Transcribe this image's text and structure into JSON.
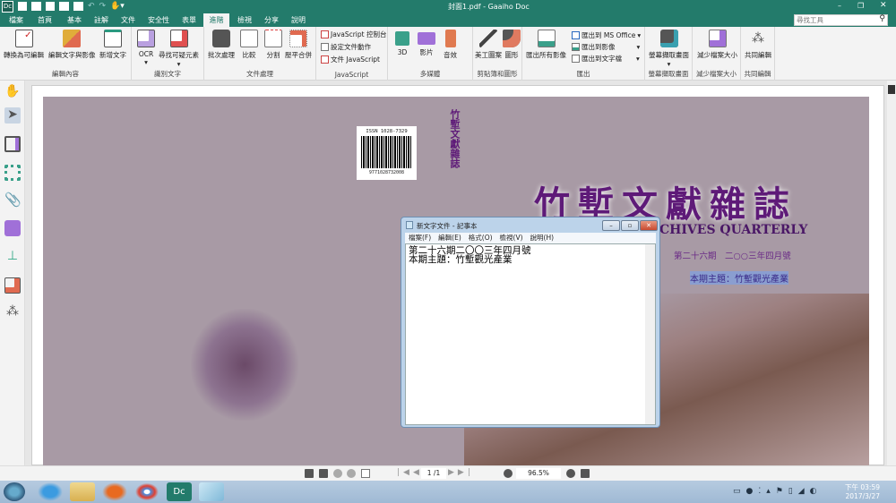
{
  "window": {
    "title": "封面1.pdf - Gaaiho Doc",
    "app_icon": "Dc",
    "minimize": "–",
    "restore": "❐",
    "close": "✕"
  },
  "quick_access": [
    "new-icon",
    "open-icon",
    "save-icon",
    "email-icon",
    "print-icon",
    "undo-icon",
    "redo-icon",
    "hand-tool-icon"
  ],
  "tabs": [
    "檔案",
    "首頁",
    "基本",
    "註解",
    "文件",
    "安全性",
    "表單",
    "進階",
    "檢視",
    "分享",
    "說明"
  ],
  "active_tab": "進階",
  "search": {
    "placeholder": "尋找工具"
  },
  "ribbon": {
    "groups": [
      {
        "label": "編輯內容",
        "buttons": [
          "轉換為可編輯",
          "編輯文字與影像",
          "新增文字"
        ]
      },
      {
        "label": "識別文字",
        "buttons": [
          "OCR",
          "尋找可疑元素"
        ]
      },
      {
        "label": "文件處理",
        "buttons": [
          "批次處理",
          "比較",
          "分割",
          "壓平合併"
        ]
      },
      {
        "label": "JavaScript",
        "buttons": [
          "JavaScript 控制台",
          "設定文件動作",
          "文件 JavaScript"
        ]
      },
      {
        "label": "多媒體",
        "buttons": [
          "3D",
          "影片",
          "音效"
        ]
      },
      {
        "label": "剪貼簿和圖形",
        "buttons": [
          "美工圖案",
          "圖形"
        ]
      },
      {
        "label": "匯出",
        "buttons": [
          "匯出所有影像",
          "匯出到 MS Office",
          "匯出到影像",
          "匯出到文字檔"
        ]
      },
      {
        "label": "螢幕擷取畫面",
        "buttons": [
          "螢幕擷取畫面"
        ]
      },
      {
        "label": "減少檔案大小",
        "buttons": [
          "減少檔案大小"
        ]
      },
      {
        "label": "共同編輯",
        "buttons": [
          "共同編輯"
        ]
      }
    ]
  },
  "cover": {
    "issn": "ISSN 1028-7329",
    "barcode_number": "9771028732008",
    "spine_title": "竹塹文獻雜誌",
    "title": "竹塹文獻雜誌",
    "subtitle_en": "CHIVES QUARTERLY",
    "issue": "第二十六期　二○○三年四月號",
    "theme": "本期主題：竹塹觀光產業"
  },
  "notepad": {
    "title": "新文字文件 - 記事本",
    "menu": [
      "檔案(F)",
      "編輯(E)",
      "格式(O)",
      "檢視(V)",
      "說明(H)"
    ],
    "lines": [
      "第二十六期二〇〇三年四月號",
      "本期主題：竹塹觀光產業"
    ]
  },
  "statusbar": {
    "page_current": "1",
    "page_total": "/1",
    "zoom": "96.5%"
  },
  "taskbar": {
    "time": "下午 03:59",
    "date": "2017/3/27"
  },
  "colors": {
    "brand": "#237b6b",
    "cover_title": "#5e1a78",
    "page_bg": "#a89aa5",
    "taskbar": "#a9c2dc"
  }
}
